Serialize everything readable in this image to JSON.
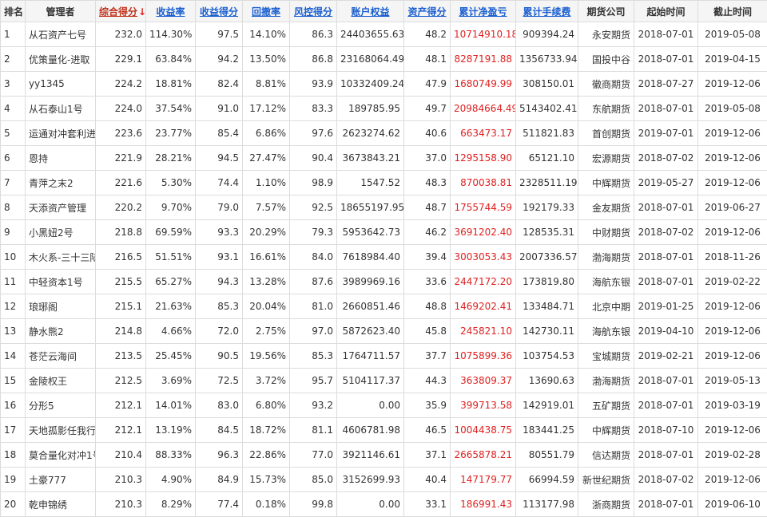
{
  "headers": {
    "rank": "排名",
    "manager": "管理者",
    "score": "综合得分",
    "score_arrow": "↓",
    "return_rate": "收益率",
    "return_score": "收益得分",
    "drawdown": "回撤率",
    "risk_score": "风控得分",
    "equity": "账户权益",
    "asset_score": "资产得分",
    "net_pnl": "累计净盈亏",
    "fees": "累计手续费",
    "broker": "期货公司",
    "start": "起始时间",
    "end": "截止时间"
  },
  "colors": {
    "link_blue": "#1a5fd0",
    "pnl_red": "#e02020",
    "header_bg": "#f5f5f5"
  },
  "rows": [
    {
      "rank": "1",
      "manager": "从石资产七号",
      "score": "232.0",
      "return_rate": "114.30%",
      "return_score": "97.5",
      "drawdown": "14.10%",
      "risk_score": "86.3",
      "equity": "24403655.63",
      "asset_score": "48.2",
      "net_pnl": "10714910.18",
      "fees": "909394.24",
      "broker": "永安期货",
      "start": "2018-07-01",
      "end": "2019-05-08"
    },
    {
      "rank": "2",
      "manager": "优策量化-进取",
      "score": "229.1",
      "return_rate": "63.84%",
      "return_score": "94.2",
      "drawdown": "13.50%",
      "risk_score": "86.8",
      "equity": "23168064.49",
      "asset_score": "48.1",
      "net_pnl": "8287191.88",
      "fees": "1356733.94",
      "broker": "国投中谷",
      "start": "2018-07-01",
      "end": "2019-04-15"
    },
    {
      "rank": "3",
      "manager": "yy1345",
      "score": "224.2",
      "return_rate": "18.81%",
      "return_score": "82.4",
      "drawdown": "8.81%",
      "risk_score": "93.9",
      "equity": "10332409.24",
      "asset_score": "47.9",
      "net_pnl": "1680749.99",
      "fees": "308150.01",
      "broker": "徽商期货",
      "start": "2018-07-27",
      "end": "2019-12-06"
    },
    {
      "rank": "4",
      "manager": "从石泰山1号",
      "score": "224.0",
      "return_rate": "37.54%",
      "return_score": "91.0",
      "drawdown": "17.12%",
      "risk_score": "83.3",
      "equity": "189785.95",
      "asset_score": "49.7",
      "net_pnl": "20984664.49",
      "fees": "5143402.41",
      "broker": "东航期货",
      "start": "2018-07-01",
      "end": "2019-05-08"
    },
    {
      "rank": "5",
      "manager": "运通对冲套利进",
      "score": "223.6",
      "return_rate": "23.77%",
      "return_score": "85.4",
      "drawdown": "6.86%",
      "risk_score": "97.6",
      "equity": "2623274.62",
      "asset_score": "40.6",
      "net_pnl": "663473.17",
      "fees": "511821.83",
      "broker": "首创期货",
      "start": "2019-07-01",
      "end": "2019-12-06"
    },
    {
      "rank": "6",
      "manager": "恩持",
      "score": "221.9",
      "return_rate": "28.21%",
      "return_score": "94.5",
      "drawdown": "27.47%",
      "risk_score": "90.4",
      "equity": "3673843.21",
      "asset_score": "37.0",
      "net_pnl": "1295158.90",
      "fees": "65121.10",
      "broker": "宏源期货",
      "start": "2018-07-02",
      "end": "2019-12-06"
    },
    {
      "rank": "7",
      "manager": "青萍之末2",
      "score": "221.6",
      "return_rate": "5.30%",
      "return_score": "74.4",
      "drawdown": "1.10%",
      "risk_score": "98.9",
      "equity": "1547.52",
      "asset_score": "48.3",
      "net_pnl": "870038.81",
      "fees": "2328511.19",
      "broker": "中辉期货",
      "start": "2019-05-27",
      "end": "2019-12-06"
    },
    {
      "rank": "8",
      "manager": "天添资产管理",
      "score": "220.2",
      "return_rate": "9.70%",
      "return_score": "79.0",
      "drawdown": "7.57%",
      "risk_score": "92.5",
      "equity": "18655197.95",
      "asset_score": "48.7",
      "net_pnl": "1755744.59",
      "fees": "192179.33",
      "broker": "金友期货",
      "start": "2018-07-01",
      "end": "2019-06-27"
    },
    {
      "rank": "9",
      "manager": "小黑妞2号",
      "score": "218.8",
      "return_rate": "69.59%",
      "return_score": "93.3",
      "drawdown": "20.29%",
      "risk_score": "79.3",
      "equity": "5953642.73",
      "asset_score": "46.2",
      "net_pnl": "3691202.40",
      "fees": "128535.31",
      "broker": "中财期货",
      "start": "2018-07-02",
      "end": "2019-12-06"
    },
    {
      "rank": "10",
      "manager": "木火系-三十三陆",
      "score": "216.5",
      "return_rate": "51.51%",
      "return_score": "93.1",
      "drawdown": "16.61%",
      "risk_score": "84.0",
      "equity": "7618984.40",
      "asset_score": "39.4",
      "net_pnl": "3003053.43",
      "fees": "2007336.57",
      "broker": "渤海期货",
      "start": "2018-07-01",
      "end": "2018-11-26"
    },
    {
      "rank": "11",
      "manager": "中轻资本1号",
      "score": "215.5",
      "return_rate": "65.27%",
      "return_score": "94.3",
      "drawdown": "13.28%",
      "risk_score": "87.6",
      "equity": "3989969.16",
      "asset_score": "33.6",
      "net_pnl": "2447172.20",
      "fees": "173819.80",
      "broker": "海航东银",
      "start": "2018-07-01",
      "end": "2019-02-22"
    },
    {
      "rank": "12",
      "manager": "琅琊阁",
      "score": "215.1",
      "return_rate": "21.63%",
      "return_score": "85.3",
      "drawdown": "20.04%",
      "risk_score": "81.0",
      "equity": "2660851.46",
      "asset_score": "48.8",
      "net_pnl": "1469202.41",
      "fees": "133484.71",
      "broker": "北京中期",
      "start": "2019-01-25",
      "end": "2019-12-06"
    },
    {
      "rank": "13",
      "manager": "静水熊2",
      "score": "214.8",
      "return_rate": "4.66%",
      "return_score": "72.0",
      "drawdown": "2.75%",
      "risk_score": "97.0",
      "equity": "5872623.40",
      "asset_score": "45.8",
      "net_pnl": "245821.10",
      "fees": "142730.11",
      "broker": "海航东银",
      "start": "2019-04-10",
      "end": "2019-12-06"
    },
    {
      "rank": "14",
      "manager": "苍茫云海间",
      "score": "213.5",
      "return_rate": "25.45%",
      "return_score": "90.5",
      "drawdown": "19.56%",
      "risk_score": "85.3",
      "equity": "1764711.57",
      "asset_score": "37.7",
      "net_pnl": "1075899.36",
      "fees": "103754.53",
      "broker": "宝城期货",
      "start": "2019-02-21",
      "end": "2019-12-06"
    },
    {
      "rank": "15",
      "manager": "金陵权王",
      "score": "212.5",
      "return_rate": "3.69%",
      "return_score": "72.5",
      "drawdown": "3.72%",
      "risk_score": "95.7",
      "equity": "5104117.37",
      "asset_score": "44.3",
      "net_pnl": "363809.37",
      "fees": "13690.63",
      "broker": "渤海期货",
      "start": "2018-07-01",
      "end": "2019-05-13"
    },
    {
      "rank": "16",
      "manager": "分形5",
      "score": "212.1",
      "return_rate": "14.01%",
      "return_score": "83.0",
      "drawdown": "6.80%",
      "risk_score": "93.2",
      "equity": "0.00",
      "asset_score": "35.9",
      "net_pnl": "399713.58",
      "fees": "142919.01",
      "broker": "五矿期货",
      "start": "2018-07-01",
      "end": "2019-03-19"
    },
    {
      "rank": "17",
      "manager": "天地孤影任我行",
      "score": "212.1",
      "return_rate": "13.19%",
      "return_score": "84.5",
      "drawdown": "18.72%",
      "risk_score": "81.1",
      "equity": "4606781.98",
      "asset_score": "46.5",
      "net_pnl": "1004438.75",
      "fees": "183441.25",
      "broker": "中辉期货",
      "start": "2018-07-10",
      "end": "2019-12-06"
    },
    {
      "rank": "18",
      "manager": "莫合量化对冲1号",
      "score": "210.4",
      "return_rate": "88.33%",
      "return_score": "96.3",
      "drawdown": "22.86%",
      "risk_score": "77.0",
      "equity": "3921146.61",
      "asset_score": "37.1",
      "net_pnl": "2665878.21",
      "fees": "80551.79",
      "broker": "信达期货",
      "start": "2018-07-01",
      "end": "2019-02-28"
    },
    {
      "rank": "19",
      "manager": "土豪777",
      "score": "210.3",
      "return_rate": "4.90%",
      "return_score": "84.9",
      "drawdown": "15.73%",
      "risk_score": "85.0",
      "equity": "3152699.93",
      "asset_score": "40.4",
      "net_pnl": "147179.77",
      "fees": "66994.59",
      "broker": "新世纪期货",
      "start": "2018-07-02",
      "end": "2019-12-06"
    },
    {
      "rank": "20",
      "manager": "乾申锦绣",
      "score": "210.3",
      "return_rate": "8.29%",
      "return_score": "77.4",
      "drawdown": "0.18%",
      "risk_score": "99.8",
      "equity": "0.00",
      "asset_score": "33.1",
      "net_pnl": "186991.43",
      "fees": "113177.98",
      "broker": "浙商期货",
      "start": "2018-07-01",
      "end": "2019-06-10"
    }
  ]
}
